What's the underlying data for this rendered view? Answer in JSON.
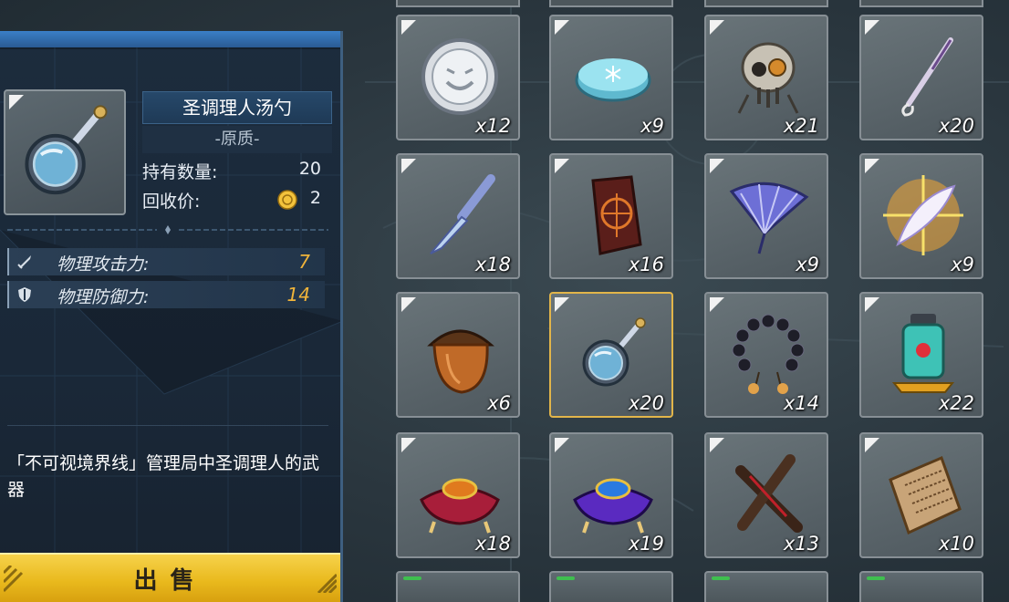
{
  "selected_item": {
    "name": "圣调理人汤勺",
    "quality": "-原质-",
    "owned_label": "持有数量:",
    "owned_value": "20",
    "recycle_label": "回收价:",
    "recycle_value": "2",
    "icon": "ladle-mirror-icon"
  },
  "attributes": [
    {
      "icon": "sword-icon",
      "label": "物理攻击力:",
      "value": "7"
    },
    {
      "icon": "shield-icon",
      "label": "物理防御力:",
      "value": "14"
    }
  ],
  "description": "「不可视境界线」管理局中圣调理人的武器",
  "sell_button": "出售",
  "colors": {
    "accent_gold": "#f0b43a",
    "sell_button": "#e9b91d",
    "panel_top": "#3a7fc7",
    "selected_border": "#e2b54a"
  },
  "inventory": [
    {
      "icon": "silver-coin-icon",
      "count": "x12"
    },
    {
      "icon": "ice-soap-icon",
      "count": "x9"
    },
    {
      "icon": "mech-skull-icon",
      "count": "x21"
    },
    {
      "icon": "quill-pen-icon",
      "count": "x20"
    },
    {
      "icon": "butterfly-knife-icon",
      "count": "x18"
    },
    {
      "icon": "rune-tablet-icon",
      "count": "x16"
    },
    {
      "icon": "folding-fan-icon",
      "count": "x9"
    },
    {
      "icon": "glowing-feather-icon",
      "count": "x9"
    },
    {
      "icon": "acorn-icon",
      "count": "x6"
    },
    {
      "icon": "ladle-mirror-icon",
      "count": "x20",
      "selected": true
    },
    {
      "icon": "prayer-beads-icon",
      "count": "x14"
    },
    {
      "icon": "lantern-icon",
      "count": "x22"
    },
    {
      "icon": "red-cushion-gem-icon",
      "count": "x18"
    },
    {
      "icon": "blue-cushion-gem-icon",
      "count": "x19"
    },
    {
      "icon": "crossed-sticks-icon",
      "count": "x13"
    },
    {
      "icon": "scroll-icon",
      "count": "x10"
    }
  ]
}
